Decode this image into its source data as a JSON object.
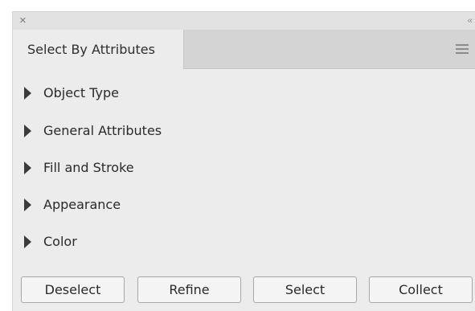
{
  "titlebar": {
    "close_glyph": "×",
    "collapse_glyph": "‹‹"
  },
  "tab": {
    "label": "Select By Attributes"
  },
  "sections": [
    {
      "label": "Object Type"
    },
    {
      "label": "General Attributes"
    },
    {
      "label": "Fill and Stroke"
    },
    {
      "label": "Appearance"
    },
    {
      "label": "Color"
    }
  ],
  "buttons": {
    "deselect": "Deselect",
    "refine": "Refine",
    "select": "Select",
    "collect": "Collect"
  }
}
